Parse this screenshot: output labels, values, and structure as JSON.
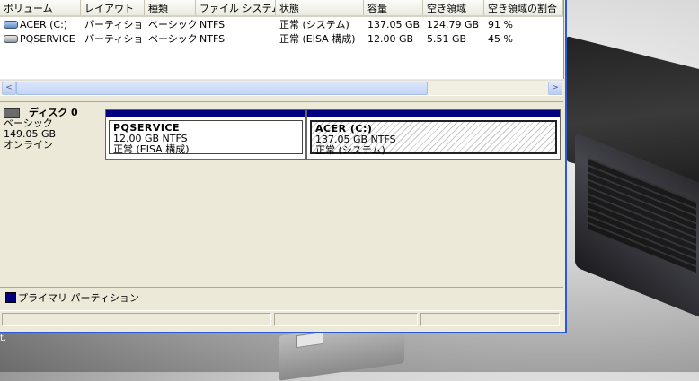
{
  "volume_list": {
    "columns": [
      "ボリューム",
      "レイアウト",
      "種類",
      "ファイル システム",
      "状態",
      "容量",
      "空き領域",
      "空き領域の割合"
    ],
    "rows": [
      [
        "ACER (C:)",
        "パーティション",
        "ベーシック",
        "NTFS",
        "正常 (システム)",
        "137.05 GB",
        "124.79 GB",
        "91 %"
      ],
      [
        "PQSERVICE",
        "パーティション",
        "ベーシック",
        "NTFS",
        "正常 (EISA 構成)",
        "12.00 GB",
        "5.51 GB",
        "45 %"
      ]
    ]
  },
  "scroll": {
    "left": "<",
    "right": ">"
  },
  "disk": {
    "name": "ディスク 0",
    "type": "ベーシック",
    "size": "149.05 GB",
    "state": "オンライン"
  },
  "partitions": [
    {
      "name": "PQSERVICE",
      "size": "12.00 GB NTFS",
      "status": "正常 (EISA 構成)"
    },
    {
      "name": "ACER  (C:)",
      "size": "137.05 GB NTFS",
      "status": "正常 (システム)"
    }
  ],
  "legend": {
    "label": "プライマリ パーティション",
    "color": "#000080"
  },
  "desktop": {
    "text": "t."
  }
}
